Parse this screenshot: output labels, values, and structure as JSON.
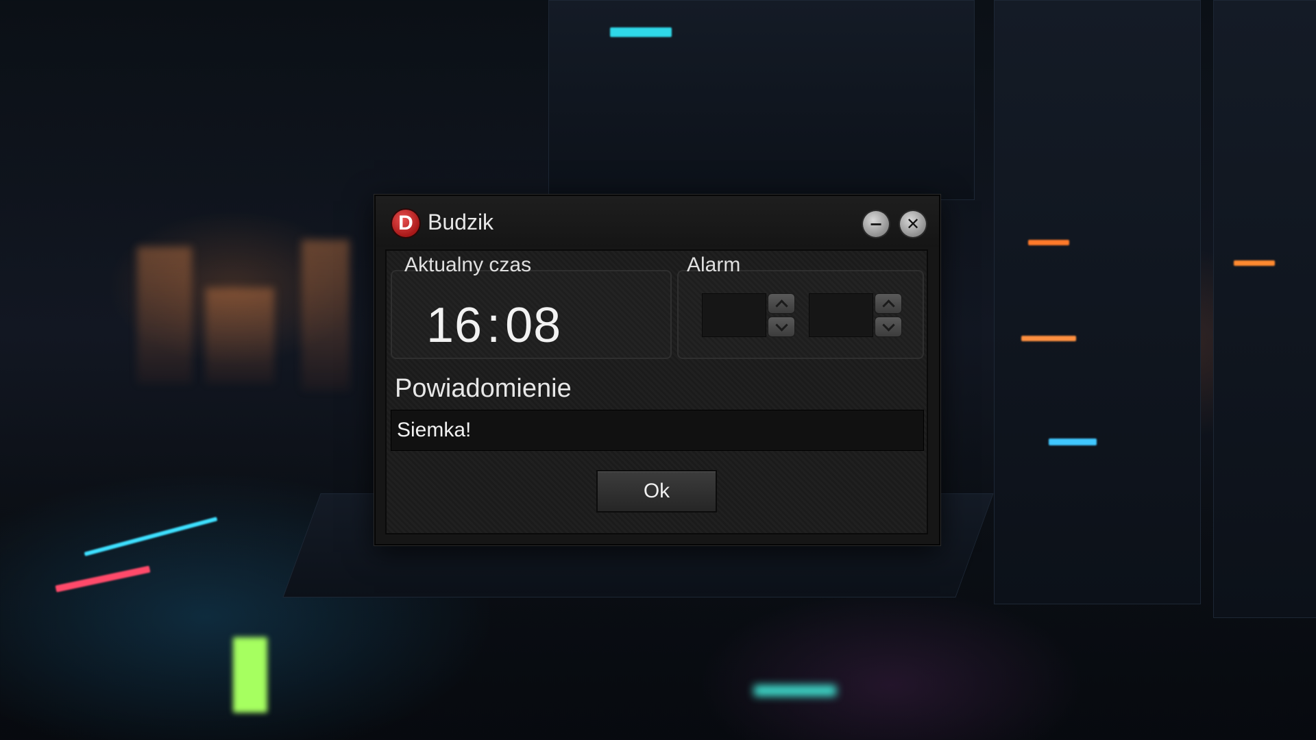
{
  "window": {
    "title": "Budzik",
    "app_icon_letter": "D",
    "minimize_glyph": "−",
    "close_glyph": "✕"
  },
  "current_time": {
    "label": "Aktualny czas",
    "hours": "16",
    "separator": ":",
    "minutes": "08"
  },
  "alarm": {
    "label": "Alarm",
    "hour_value": "",
    "minute_value": ""
  },
  "notification": {
    "label": "Powiadomienie",
    "value": "Siemka!"
  },
  "ok_button": {
    "label": "Ok"
  }
}
